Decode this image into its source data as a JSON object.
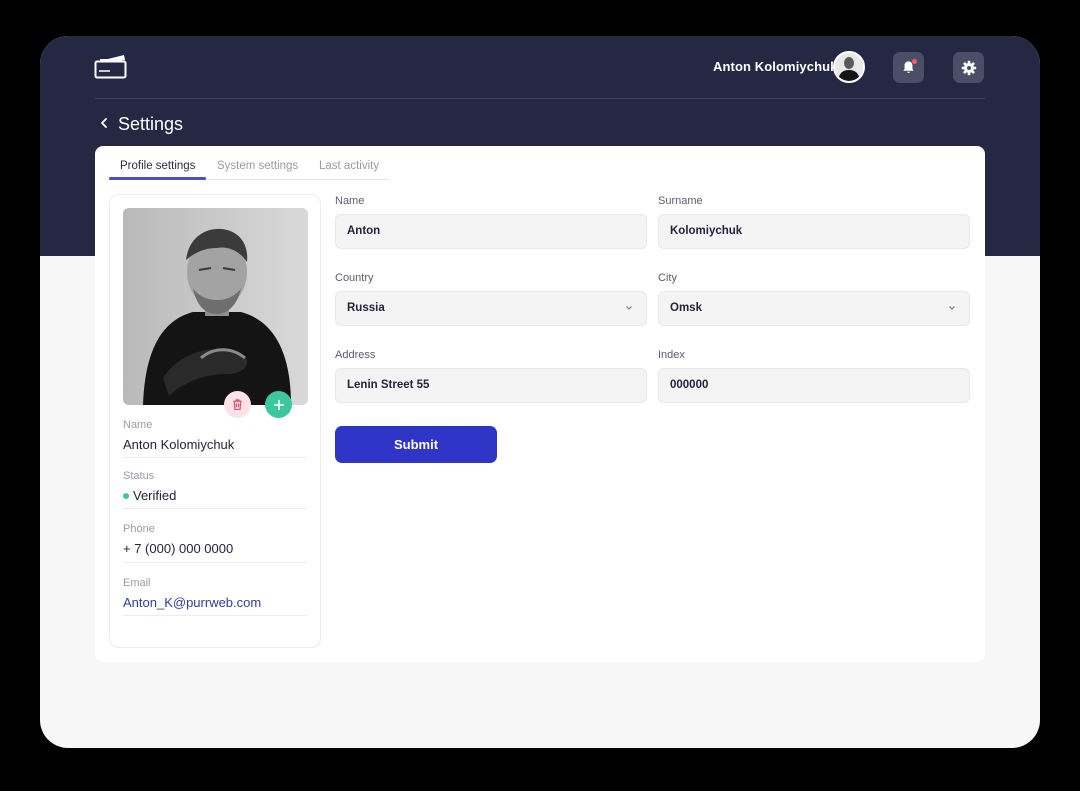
{
  "header": {
    "user_name": "Anton Kolomiychuk",
    "page_title": "Settings"
  },
  "tabs": [
    {
      "label": "Profile settings",
      "active": true
    },
    {
      "label": "System settings",
      "active": false
    },
    {
      "label": "Last activity",
      "active": false
    }
  ],
  "profile": {
    "name_label": "Name",
    "name_value": "Anton Kolomiychuk",
    "status_label": "Status",
    "status_value": "Verified",
    "phone_label": "Phone",
    "phone_value": "+ 7 (000) 000 0000",
    "email_label": "Email",
    "email_value": "Anton_K@purrweb.com"
  },
  "form": {
    "name_label": "Name",
    "name_value": "Anton",
    "surname_label": "Surname",
    "surname_value": "Kolomiychuk",
    "country_label": "Country",
    "country_value": "Russia",
    "city_label": "City",
    "city_value": "Omsk",
    "address_label": "Address",
    "address_value": "Lenin Street 55",
    "index_label": "Index",
    "index_value": "000000",
    "submit_label": "Submit"
  },
  "colors": {
    "header_bg": "#252842",
    "accent": "#2f35c7",
    "tab_underline": "#4b4fc3",
    "verified": "#3cc79e",
    "add_button": "#3cc79e",
    "delete_button_bg": "#fde3e7",
    "notification_dot": "#ff5a6e"
  },
  "icons": {
    "logo": "wallet-logo-icon",
    "back": "chevron-left-icon",
    "bell": "bell-icon",
    "gear": "gear-icon",
    "delete": "trash-icon",
    "add": "plus-icon",
    "dropdown": "chevron-down-icon"
  }
}
